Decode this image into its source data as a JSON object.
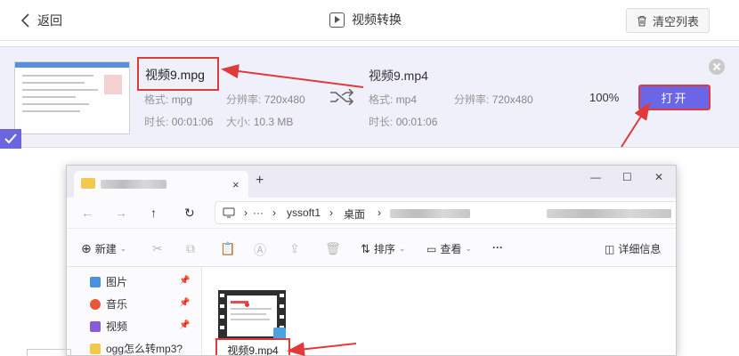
{
  "topbar": {
    "back_label": "返回",
    "title": "视频转换",
    "clear_label": "清空列表"
  },
  "conversion": {
    "source": {
      "name": "视频9.mpg",
      "format_label": "格式:",
      "format": "mpg",
      "resolution_label": "分辨率:",
      "resolution": "720x480",
      "duration_label": "时长:",
      "duration": "00:01:06",
      "size_label": "大小:",
      "size": "10.3 MB"
    },
    "target": {
      "name": "视频9.mp4",
      "format_label": "格式:",
      "format": "mp4",
      "resolution_label": "分辨率:",
      "resolution": "720x480",
      "duration_label": "时长:",
      "duration": "00:01:06"
    },
    "progress": "100%",
    "open_label": "打开"
  },
  "explorer": {
    "tab_close": "×",
    "new_tab": "+",
    "controls": {
      "minimize": "—",
      "maximize": "☐",
      "close": "✕"
    },
    "nav": {
      "back": "←",
      "forward": "→",
      "up": "↑",
      "refresh": "↻"
    },
    "breadcrumb": [
      "yssoft1",
      "桌面"
    ],
    "commands": {
      "new_label": "新建",
      "sort_label": "排序",
      "view_label": "查看",
      "more_label": "···",
      "details_label": "详细信息"
    },
    "quick_access": [
      {
        "label": "图片",
        "color": "#4a8fe0",
        "pinned": true
      },
      {
        "label": "音乐",
        "color": "#e8573a",
        "pinned": true
      },
      {
        "label": "视频",
        "color": "#8a5bd6",
        "pinned": true
      },
      {
        "label": "ogg怎么转mp3?",
        "color": "#f2c94c",
        "pinned": false
      }
    ],
    "file": {
      "name": "视频9.mp4"
    }
  },
  "colors": {
    "accent": "#6b66e6",
    "highlight": "#e03a3a",
    "row_bg": "#eff0fa"
  }
}
